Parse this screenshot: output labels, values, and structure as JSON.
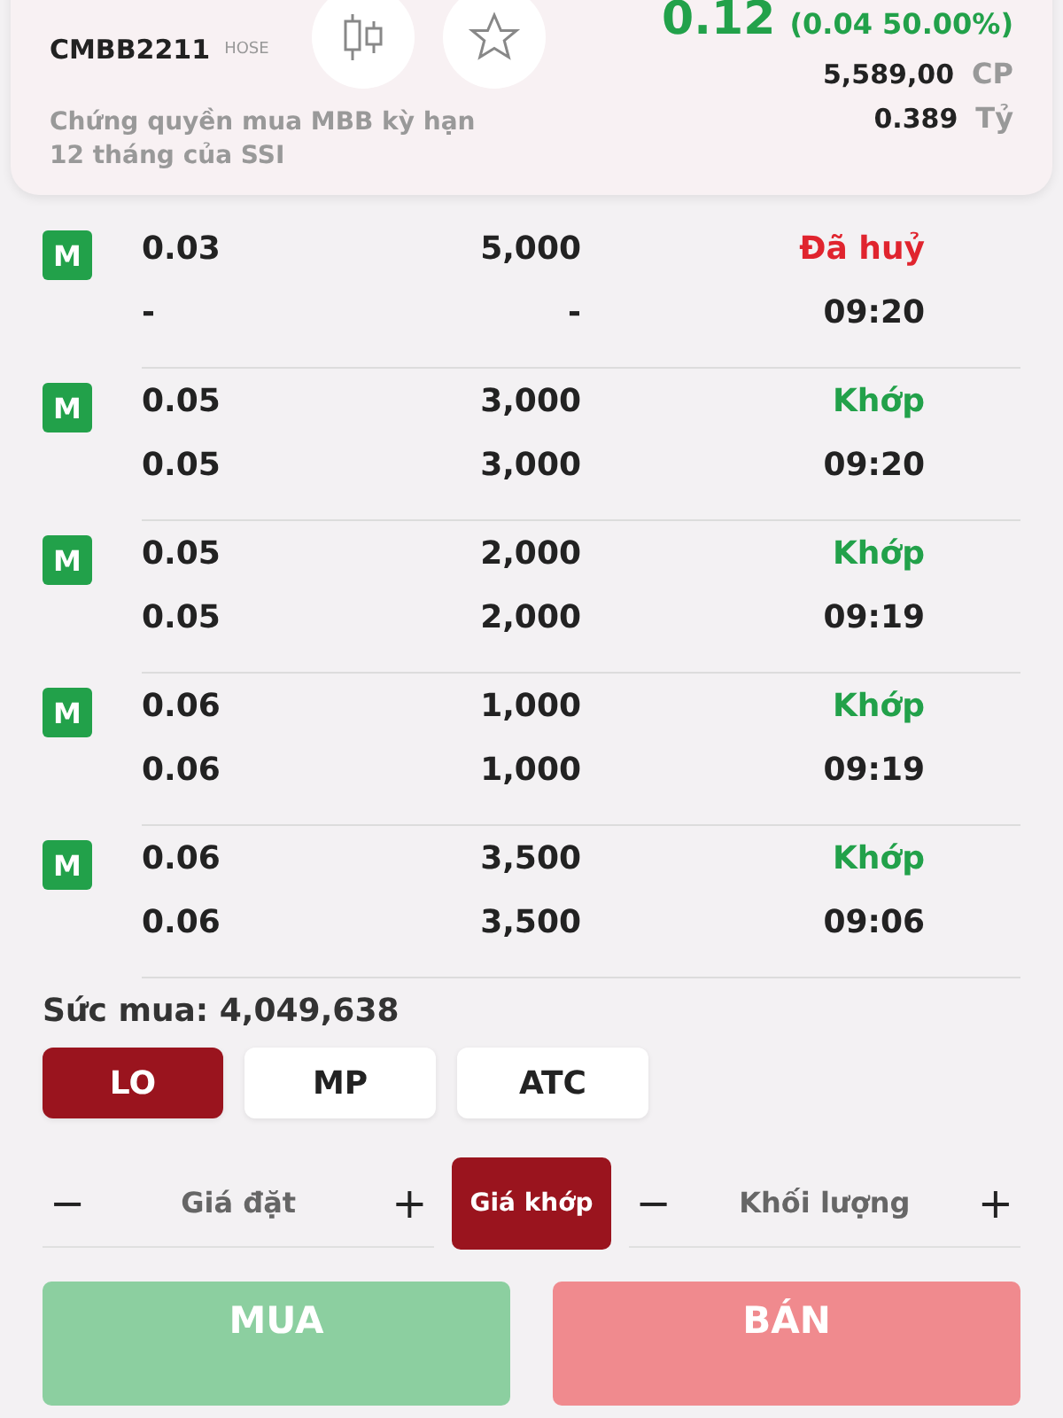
{
  "header": {
    "symbol": "CMBB2211",
    "exchange": "HOSE",
    "name": "Chứng quyền mua MBB kỳ hạn 12 tháng của SSI",
    "price": "0.12",
    "change": "(0.04 50.00%)",
    "volume": "5,589,00",
    "volume_unit": "CP",
    "value": "0.389",
    "value_unit": "Tỷ",
    "favorite": false
  },
  "orders": [
    {
      "side": "M",
      "price": "0.03",
      "qty": "5,000",
      "status": "Đã huỷ",
      "kind": "cancelled",
      "match_price": "-",
      "match_qty": "-",
      "time": "09:20"
    },
    {
      "side": "M",
      "price": "0.05",
      "qty": "3,000",
      "status": "Khớp",
      "kind": "matched",
      "match_price": "0.05",
      "match_qty": "3,000",
      "time": "09:20"
    },
    {
      "side": "M",
      "price": "0.05",
      "qty": "2,000",
      "status": "Khớp",
      "kind": "matched",
      "match_price": "0.05",
      "match_qty": "2,000",
      "time": "09:19"
    },
    {
      "side": "M",
      "price": "0.06",
      "qty": "1,000",
      "status": "Khớp",
      "kind": "matched",
      "match_price": "0.06",
      "match_qty": "1,000",
      "time": "09:19"
    },
    {
      "side": "M",
      "price": "0.06",
      "qty": "3,500",
      "status": "Khớp",
      "kind": "matched",
      "match_price": "0.06",
      "match_qty": "3,500",
      "time": "09:06"
    }
  ],
  "buying_power": "Sức mua: 4,049,638",
  "order_types": [
    {
      "label": "LO",
      "selected": true
    },
    {
      "label": "MP",
      "selected": false
    },
    {
      "label": "ATC",
      "selected": false
    }
  ],
  "price_field": {
    "placeholder": "Giá đặt",
    "minus": "−",
    "plus": "+"
  },
  "market_price": {
    "label": "Giá khớp",
    "on": true
  },
  "qty_field": {
    "placeholder": "Khối lượng",
    "minus": "−",
    "plus": "+"
  },
  "buttons": [
    {
      "label": "MUA",
      "kind": "buy"
    },
    {
      "label": "BÁN",
      "kind": "sell"
    }
  ]
}
